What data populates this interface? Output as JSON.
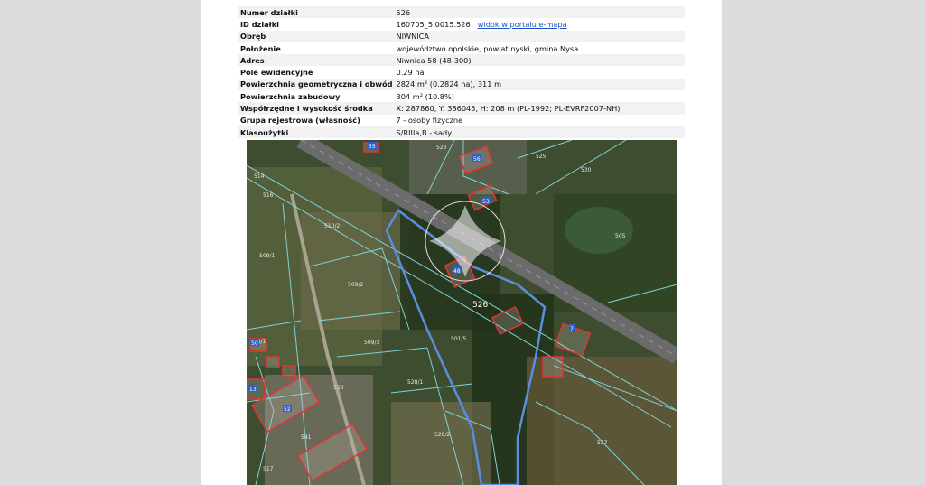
{
  "parcel": {
    "rows": [
      {
        "key": "Numer działki",
        "value": "526"
      },
      {
        "key": "ID działki",
        "value": "160705_5.0015.526",
        "link": "widok w portalu e-mapa"
      },
      {
        "key": "Obręb",
        "value": "NIWNICA"
      },
      {
        "key": "Położenie",
        "value": "województwo opolskie, powiat nyski, gmina Nysa"
      },
      {
        "key": "Adres",
        "value": "Niwnica 58 (48-300)"
      },
      {
        "key": "Pole ewidencyjne",
        "value": "0.29 ha"
      },
      {
        "key": "Powierzchnia geometryczna i obwód",
        "value": "2824 m² (0.2824 ha), 311 m"
      },
      {
        "key": "Powierzchnia zabudowy",
        "value": "304 m² (10.8%)"
      },
      {
        "key": "Współrzędne i wysokość środka",
        "value": "X: 287860, Y: 386045, H: 208 m (PL-1992; PL-EVRF2007-NH)"
      },
      {
        "key": "Grupa rejestrowa (własność)",
        "value": "7 - osoby fizyczne"
      },
      {
        "key": "Klasoużytki",
        "value": "S/RIIIa,B - sady"
      }
    ]
  },
  "map": {
    "selected_parcel_label": "526",
    "parcel_labels": [
      "523",
      "525",
      "530",
      "514",
      "516",
      "510/2",
      "509/2",
      "509/1",
      "505",
      "509/3",
      "527",
      "528/1",
      "528/2",
      "533",
      "541",
      "501/5",
      "517",
      "508/1"
    ],
    "building_labels": [
      "55",
      "56",
      "53",
      "50",
      "52",
      "13",
      "7",
      "48"
    ],
    "colors": {
      "parcel_line": "#7fd3d6",
      "selected_outline": "#5a8fe0",
      "building": "#e03434",
      "road": "#6b6b6b"
    }
  }
}
